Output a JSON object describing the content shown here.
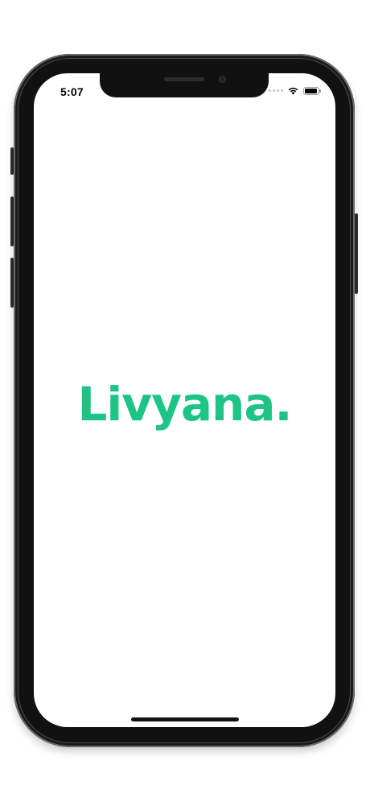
{
  "status_bar": {
    "time": "5:07",
    "icons": [
      "cellular-signal-icon",
      "wifi-icon",
      "battery-icon"
    ],
    "battery_level": 0.95
  },
  "splash": {
    "logo_text": "Livyana."
  },
  "colors": {
    "brand_green": "#1dc486",
    "phone_frame": "#2b2b2b",
    "screen_background": "#ffffff"
  }
}
